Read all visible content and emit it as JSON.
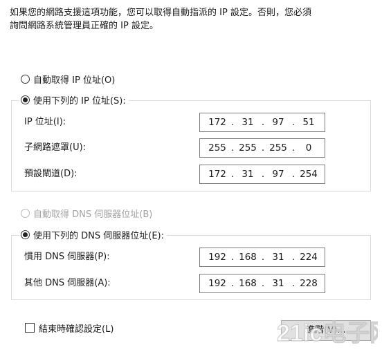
{
  "description": {
    "line1": "如果您的網路支援這項功能，您可以取得自動指派的 IP 設定。否則，您必須",
    "line2": "詢問網路系統管理員正確的 IP 設定。"
  },
  "ip_section": {
    "auto_label": "自動取得 IP 位址(O)",
    "manual_label": "使用下列的 IP 位址(S):",
    "selected": "manual",
    "fields": [
      {
        "label": "IP 位址(I):",
        "octets": [
          "172",
          "31",
          "97",
          "51"
        ]
      },
      {
        "label": "子網路遮罩(U):",
        "octets": [
          "255",
          "255",
          "255",
          "0"
        ]
      },
      {
        "label": "預設閘道(D):",
        "octets": [
          "172",
          "31",
          "97",
          "254"
        ]
      }
    ]
  },
  "dns_section": {
    "auto_label": "自動取得 DNS 伺服器位址(B)",
    "manual_label": "使用下列的 DNS 伺服器位址(E):",
    "selected": "manual",
    "fields": [
      {
        "label": "慣用 DNS 伺服器(P):",
        "octets": [
          "192",
          "168",
          "31",
          "224"
        ]
      },
      {
        "label": "其他 DNS 伺服器(A):",
        "octets": [
          "192",
          "168",
          "31",
          "228"
        ]
      }
    ]
  },
  "validate_label": "結束時確認設定(L)",
  "advanced_button": "進階(V)...",
  "watermark": "21ic电子网"
}
